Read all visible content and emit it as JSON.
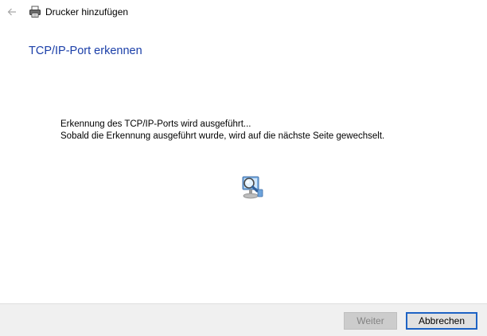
{
  "window": {
    "title": "Drucker hinzufügen",
    "back_icon": "back-arrow-icon",
    "app_icon": "printer-icon"
  },
  "page": {
    "heading": "TCP/IP-Port erkennen",
    "status_line_1": "Erkennung des TCP/IP-Ports wird ausgeführt...",
    "status_line_2": "Sobald die Erkennung ausgeführt wurde, wird auf die nächste Seite gewechselt.",
    "animation_icon": "computer-search-icon"
  },
  "footer": {
    "next_label": "Weiter",
    "cancel_label": "Abbrechen"
  },
  "colors": {
    "heading": "#1a3ea8",
    "footer_bg": "#f0f0f0",
    "focus_border": "#1e63c4"
  }
}
